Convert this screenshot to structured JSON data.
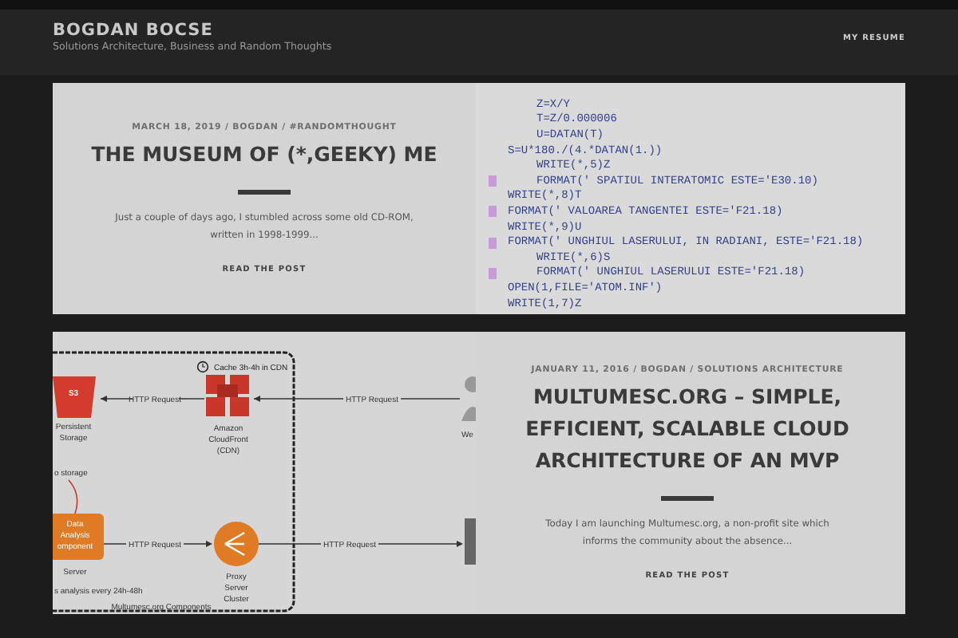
{
  "header": {
    "site_title": "BOGDAN BOCSE",
    "tagline": "Solutions Architecture, Business and Random Thoughts",
    "nav": [
      {
        "label": "MY RESUME"
      }
    ]
  },
  "posts": [
    {
      "kind": "code",
      "image_first": false,
      "meta": "MARCH 18, 2019 / BOGDAN / #RANDOMTHOUGHT",
      "title": "THE MUSEUM OF (*,GEEKY) ME",
      "excerpt": "Just a couple of days ago, I stumbled across some old CD-ROM, written in 1998-1999...",
      "read_more": "READ THE POST",
      "code_lines": [
        {
          "text": "Z=X/Y",
          "indented": true,
          "marker": false
        },
        {
          "text": "T=Z/0.000006",
          "indented": true,
          "marker": false
        },
        {
          "text": "U=DATAN(T)",
          "indented": true,
          "marker": false
        },
        {
          "text": "S=U*180./(4.*DATAN(1.))",
          "indented": false,
          "marker": false
        },
        {
          "text": "WRITE(*,5)Z",
          "indented": true,
          "marker": false
        },
        {
          "text": "FORMAT(' SPATIUL INTERATOMIC ESTE='E30.10)",
          "indented": true,
          "marker": true
        },
        {
          "text": "WRITE(*,8)T",
          "indented": false,
          "marker": false
        },
        {
          "text": "FORMAT(' VALOAREA TANGENTEI ESTE='F21.18)",
          "indented": false,
          "marker": true
        },
        {
          "text": "WRITE(*,9)U",
          "indented": false,
          "marker": false
        },
        {
          "text": "FORMAT(' UNGHIUL LASERULUI, IN RADIANI, ESTE='F21.18)",
          "indented": false,
          "marker": true
        },
        {
          "text": "WRITE(*,6)S",
          "indented": true,
          "marker": false
        },
        {
          "text": "FORMAT(' UNGHIUL LASERULUI ESTE='F21.18)",
          "indented": true,
          "marker": true
        },
        {
          "text": "OPEN(1,FILE='ATOM.INF')",
          "indented": false,
          "marker": false
        },
        {
          "text": "WRITE(1,7)Z",
          "indented": false,
          "marker": false
        }
      ]
    },
    {
      "kind": "diagram",
      "image_first": true,
      "meta": "JANUARY 11, 2016 / BOGDAN / SOLUTIONS ARCHITECTURE",
      "title": "MULTUMESC.ORG – SIMPLE, EFFICIENT, SCALABLE CLOUD ARCHITECTURE OF AN MVP",
      "excerpt": "Today I am launching Multumesc.org, a non-profit site which informs the community about the absence...",
      "read_more": "READ THE POST",
      "diagram_labels": [
        "Cache 3h-4h in CDN",
        "S3",
        "Persistent",
        "Storage",
        "HTTP Request",
        "Amazon",
        "CloudFront",
        "(CDN)",
        "HTTP Request",
        "We",
        "o storage",
        "Data",
        "Analysis",
        "omponent",
        "Server",
        "HTTP Request",
        "Proxy",
        "Server",
        "Cluster",
        "HTTP Request",
        "s analysis every 24h-48h",
        "Multumesc.org Components"
      ]
    }
  ]
}
